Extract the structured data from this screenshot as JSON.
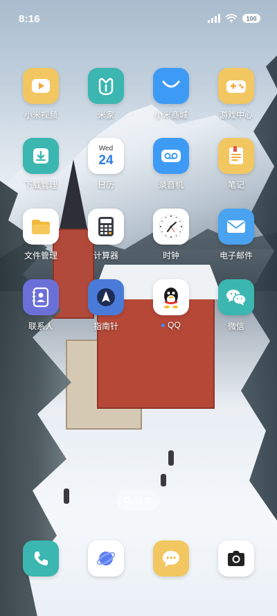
{
  "status": {
    "time": "8:16",
    "battery": "100"
  },
  "apps": [
    {
      "label": "小米视频",
      "icon": "video-play-icon",
      "color": "#f2c761"
    },
    {
      "label": "米家",
      "icon": "mijia-icon",
      "color": "#3bb6b0"
    },
    {
      "label": "小米商城",
      "icon": "mi-store-icon",
      "color": "#3e9bf5"
    },
    {
      "label": "游戏中心",
      "icon": "game-controller-icon",
      "color": "#f2c761"
    },
    {
      "label": "下载管理",
      "icon": "download-icon",
      "color": "#3bb6b0"
    },
    {
      "label": "日历",
      "icon": "calendar-icon",
      "color": "#ffffff",
      "weekday": "Wed",
      "day": "24"
    },
    {
      "label": "录音机",
      "icon": "recorder-icon",
      "color": "#3e9bf5"
    },
    {
      "label": "笔记",
      "icon": "notes-icon",
      "color": "#f2c761"
    },
    {
      "label": "文件管理",
      "icon": "folder-icon",
      "color": "#ffffff"
    },
    {
      "label": "计算器",
      "icon": "calculator-icon",
      "color": "#ffffff"
    },
    {
      "label": "时钟",
      "icon": "clock-icon",
      "color": "#ffffff"
    },
    {
      "label": "电子邮件",
      "icon": "mail-icon",
      "color": "#4aa3f0"
    },
    {
      "label": "联系人",
      "icon": "contacts-icon",
      "color": "#6b70d9"
    },
    {
      "label": "指南针",
      "icon": "compass-icon",
      "color": "#4a7bd8"
    },
    {
      "label": "QQ",
      "icon": "qq-penguin-icon",
      "color": "#ffffff"
    },
    {
      "label": "微信",
      "icon": "wechat-icon",
      "color": "#3bb6b0"
    }
  ],
  "search": {
    "label": "搜索"
  },
  "dock": [
    {
      "name": "phone",
      "icon": "phone-icon",
      "color": "#3bb6b0"
    },
    {
      "name": "browser",
      "icon": "browser-planet-icon",
      "color": "#ffffff"
    },
    {
      "name": "messages",
      "icon": "messages-icon",
      "color": "#f2c761"
    },
    {
      "name": "camera",
      "icon": "camera-icon",
      "color": "#ffffff"
    }
  ]
}
